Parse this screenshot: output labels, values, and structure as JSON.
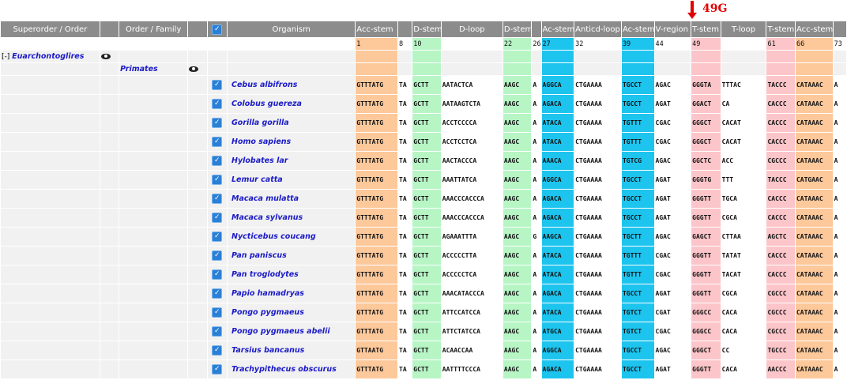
{
  "annotation": {
    "label": "49G"
  },
  "headers": [
    "Superorder / Order",
    "",
    "Order / Family",
    "",
    "",
    "Organism",
    "Acc-stem",
    "",
    "D-stem",
    "D-loop",
    "D-stem",
    "",
    "Ac-stem",
    "Anticd-loop",
    "Ac-stem",
    "V-region",
    "T-stem",
    "T-loop",
    "T-stem",
    "Acc-stem",
    ""
  ],
  "positions": [
    "",
    "",
    "",
    "",
    "",
    "",
    "1",
    "8",
    "10",
    "",
    "22",
    "26",
    "27",
    "32",
    "39",
    "44",
    "49",
    "",
    "61",
    "66",
    "73"
  ],
  "tree": {
    "superorder": "Euarchontoglires",
    "expander": "[-]",
    "order": "Primates"
  },
  "rows": [
    {
      "organism": "Cebus albifrons",
      "seq": [
        "GTTTATG",
        "TA",
        "GCTT",
        "AATACTCA",
        "AAGC",
        "A",
        "AGGCA",
        "CTGAAAA",
        "TGCCT",
        "AGAC",
        "GGGTA",
        "TTTAC",
        "TACCC",
        "CATAAAC",
        "A"
      ]
    },
    {
      "organism": "Colobus guereza",
      "seq": [
        "GTTTATG",
        "TA",
        "GCTT",
        "AATAAGTCTA",
        "AAGC",
        "A",
        "AGACA",
        "CTGAAAA",
        "TGCCT",
        "AGAT",
        "GGACT",
        "CA",
        "CACCC",
        "CATAAAC",
        "A"
      ]
    },
    {
      "organism": "Gorilla gorilla",
      "seq": [
        "GTTTATG",
        "TA",
        "GCTT",
        "ACCTCCCCA",
        "AAGC",
        "A",
        "ATACA",
        "CTGAAAA",
        "TGTTT",
        "CGAC",
        "GGGCT",
        "CACAT",
        "CACCC",
        "CATAAAC",
        "A"
      ]
    },
    {
      "organism": "Homo sapiens",
      "seq": [
        "GTTTATG",
        "TA",
        "GCTT",
        "ACCTCCTCA",
        "AAGC",
        "A",
        "ATACA",
        "CTGAAAA",
        "TGTTT",
        "CGAC",
        "GGGCT",
        "CACAT",
        "CACCC",
        "CATAAAC",
        "A"
      ]
    },
    {
      "organism": "Hylobates lar",
      "seq": [
        "GTTTATG",
        "TA",
        "GCTT",
        "AACTACCCA",
        "AAGC",
        "A",
        "AAACA",
        "CTGAAAA",
        "TGTCG",
        "AGAC",
        "GGCTC",
        "ACC",
        "CGCCC",
        "CATAAAC",
        "A"
      ]
    },
    {
      "organism": "Lemur catta",
      "seq": [
        "GTTTATG",
        "TA",
        "GCTT",
        "AAATTATCA",
        "AAGC",
        "A",
        "AGGCA",
        "CTGAAAA",
        "TGCCT",
        "AGAT",
        "GGGTG",
        "TTT",
        "TACCC",
        "CATGAAC",
        "A"
      ]
    },
    {
      "organism": "Macaca mulatta",
      "seq": [
        "GTTTATG",
        "TA",
        "GCTT",
        "AAACCCACCCA",
        "AAGC",
        "A",
        "AGACA",
        "CTGAAAA",
        "TGCCT",
        "AGAT",
        "GGGTT",
        "TGCA",
        "CACCC",
        "CATAAAC",
        "A"
      ]
    },
    {
      "organism": "Macaca sylvanus",
      "seq": [
        "GTTTATG",
        "TA",
        "GCTT",
        "AAACCCACCCA",
        "AAGC",
        "A",
        "AGACA",
        "CTGAAAA",
        "TGCCT",
        "AGAT",
        "GGGTT",
        "CGCA",
        "CACCC",
        "CATAAAC",
        "A"
      ]
    },
    {
      "organism": "Nycticebus coucang",
      "seq": [
        "GTTTATG",
        "TA",
        "GCTT",
        "AGAAATTTA",
        "AAGC",
        "G",
        "AAGCA",
        "CTGAAAA",
        "TGCTT",
        "AGAC",
        "GAGCT",
        "CTTAA",
        "AGCTC",
        "CATAAAC",
        "A"
      ]
    },
    {
      "organism": "Pan paniscus",
      "seq": [
        "GTTTATG",
        "TA",
        "GCTT",
        "ACCCCCTTA",
        "AAGC",
        "A",
        "ATACA",
        "CTGAAAA",
        "TGTTT",
        "CGAC",
        "GGGTT",
        "TATAT",
        "CACCC",
        "CATAAAC",
        "A"
      ]
    },
    {
      "organism": "Pan troglodytes",
      "seq": [
        "GTTTATG",
        "TA",
        "GCTT",
        "ACCCCCTCA",
        "AAGC",
        "A",
        "ATACA",
        "CTGAAAA",
        "TGTTT",
        "CGAC",
        "GGGTT",
        "TACAT",
        "CACCC",
        "CATAAAC",
        "A"
      ]
    },
    {
      "organism": "Papio hamadryas",
      "seq": [
        "GTTTATG",
        "TA",
        "GCTT",
        "AAACATACCCA",
        "AAGC",
        "A",
        "AGACA",
        "CTGAAAA",
        "TGCCT",
        "AGAT",
        "GGGTT",
        "CGCA",
        "CGCCC",
        "CATAAAC",
        "A"
      ]
    },
    {
      "organism": "Pongo pygmaeus",
      "seq": [
        "GTTTATG",
        "TA",
        "GCTT",
        "ATTCCATCCA",
        "AAGC",
        "A",
        "ATACA",
        "CTGAAAA",
        "TGTCT",
        "CGAT",
        "GGGCC",
        "CACA",
        "CGCCC",
        "CATAAAC",
        "A"
      ]
    },
    {
      "organism": "Pongo pygmaeus abelii",
      "seq": [
        "GTTTATG",
        "TA",
        "GCTT",
        "ATTCTATCCA",
        "AAGC",
        "A",
        "ATGCA",
        "CTGAAAA",
        "TGTCT",
        "CGAC",
        "GGGCC",
        "CACA",
        "CGCCC",
        "CATAAAC",
        "A"
      ]
    },
    {
      "organism": "Tarsius bancanus",
      "seq": [
        "GTTAATG",
        "TA",
        "GCTT",
        "ACAACCAA",
        "AAGC",
        "A",
        "AGGCA",
        "CTGAAAA",
        "TGCCT",
        "AGAC",
        "GGGCT",
        "CC",
        "TGCCC",
        "CATAAAC",
        "A"
      ]
    },
    {
      "organism": "Trachypithecus obscurus",
      "seq": [
        "GTTTATG",
        "TA",
        "GCTT",
        "AATTTTCCCA",
        "AAGC",
        "A",
        "AGACA",
        "CTGAAAA",
        "TGCCT",
        "AGAT",
        "GGGTT",
        "CACA",
        "AACCC",
        "CATAAAC",
        "A"
      ]
    }
  ],
  "colors": {
    "acc_stem": "#fdc89a",
    "d_stem": "#b7f5c5",
    "ac_stem": "#1dc4ee",
    "t_stem": "#fcc5c9",
    "header": "#8c8c8c",
    "annotation": "#e00000"
  },
  "icons": {
    "eye": "eye-icon",
    "checkbox": "checkbox-checked-icon",
    "arrow": "arrow-down-icon"
  }
}
